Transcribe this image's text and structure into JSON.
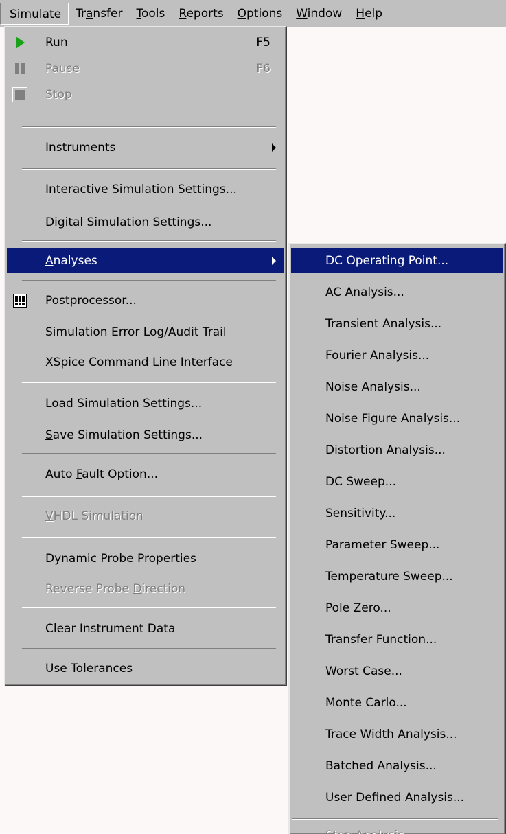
{
  "menubar": {
    "items": [
      {
        "pre": "",
        "u": "S",
        "post": "imulate"
      },
      {
        "pre": "Tr",
        "u": "a",
        "post": "nsfer"
      },
      {
        "pre": "",
        "u": "T",
        "post": "ools"
      },
      {
        "pre": "",
        "u": "R",
        "post": "eports"
      },
      {
        "pre": "",
        "u": "O",
        "post": "ptions"
      },
      {
        "pre": "",
        "u": "W",
        "post": "indow"
      },
      {
        "pre": "",
        "u": "H",
        "post": "elp"
      }
    ]
  },
  "simulate_menu": {
    "run": {
      "label": "Run",
      "shortcut": "F5",
      "icon": "play-icon"
    },
    "pause": {
      "label": "Pause",
      "shortcut": "F6",
      "icon": "pause-icon"
    },
    "stop": {
      "label": "Stop",
      "icon": "stop-icon"
    },
    "instruments": {
      "pre": "",
      "u": "I",
      "post": "nstruments"
    },
    "interactive_settings": {
      "pre": "Interactive Simulation Settings...",
      "u": "",
      "post": ""
    },
    "digital_settings": {
      "pre": "",
      "u": "D",
      "post": "igital Simulation Settings..."
    },
    "analyses": {
      "pre": "",
      "u": "A",
      "post": "nalyses"
    },
    "postprocessor": {
      "pre": "",
      "u": "P",
      "post": "ostprocessor...",
      "icon": "postprocessor-icon"
    },
    "error_log": {
      "pre": "Simulation Error Log/Audit Trail",
      "u": "",
      "post": ""
    },
    "xspice": {
      "pre": "",
      "u": "X",
      "post": "Spice Command Line Interface"
    },
    "load_settings": {
      "pre": "",
      "u": "L",
      "post": "oad Simulation Settings..."
    },
    "save_settings": {
      "pre": "",
      "u": "S",
      "post": "ave Simulation Settings..."
    },
    "auto_fault": {
      "pre": "Auto ",
      "u": "F",
      "post": "ault Option..."
    },
    "vhdl": {
      "pre": "",
      "u": "V",
      "post": "HDL Simulation"
    },
    "dynamic_probe": {
      "pre": "Dynamic Probe Properties",
      "u": "",
      "post": ""
    },
    "reverse_probe": {
      "pre": "Reverse Probe ",
      "u": "D",
      "post": "irection"
    },
    "clear_data": {
      "pre": "Clear Instrument Data",
      "u": "",
      "post": ""
    },
    "use_tolerances": {
      "pre": "",
      "u": "U",
      "post": "se Tolerances"
    }
  },
  "analyses_menu": {
    "items": [
      "DC Operating Point...",
      "AC Analysis...",
      "Transient Analysis...",
      "Fourier Analysis...",
      "Noise Analysis...",
      "Noise Figure Analysis...",
      "Distortion Analysis...",
      "DC Sweep...",
      "Sensitivity...",
      "Parameter Sweep...",
      "Temperature Sweep...",
      "Pole Zero...",
      "Transfer Function...",
      "Worst Case...",
      "Monte Carlo...",
      "Trace Width Analysis...",
      "Batched Analysis...",
      "User Defined Analysis..."
    ],
    "stop_analysis": "Stop Analysis"
  },
  "colors": {
    "menu_bg": "#c0c0c0",
    "highlight": "#0a1a78",
    "disabled": "#808080",
    "run_icon": "#19a119"
  }
}
